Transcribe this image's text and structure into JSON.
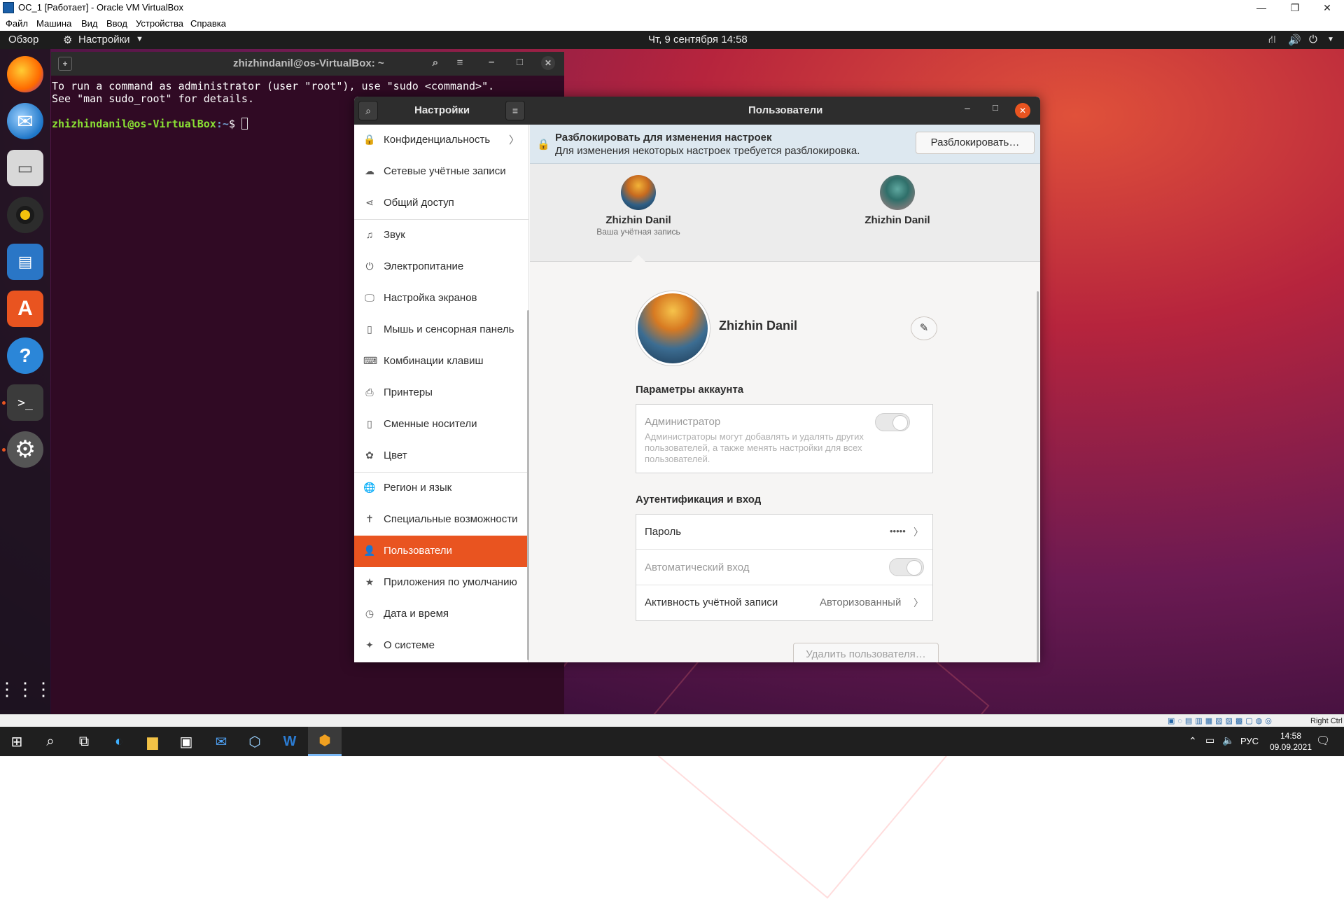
{
  "vbox": {
    "title": "ОС_1 [Работает] - Oracle VM VirtualBox",
    "menu": [
      "Файл",
      "Машина",
      "Вид",
      "Ввод",
      "Устройства",
      "Справка"
    ],
    "status_host_key": "Right Ctrl"
  },
  "topbar": {
    "activities": "Обзор",
    "app_menu": "Настройки",
    "clock": "Чт, 9 сентября  14:58"
  },
  "terminal": {
    "title": "zhizhindanil@os-VirtualBox: ~",
    "line1": "To run a command as administrator (user \"root\"), use \"sudo <command>\".",
    "line2": "See \"man sudo_root\" for details.",
    "prompt_user": "zhizhindanil@os-VirtualBox",
    "prompt_path": ":~",
    "prompt_sign": "$ "
  },
  "settings": {
    "sidebar_title": "Настройки",
    "page_title": "Пользователи",
    "sidebar_items": [
      "Конфиденциальность",
      "Сетевые учётные записи",
      "Общий доступ",
      "Звук",
      "Электропитание",
      "Настройка экранов",
      "Мышь и сенсорная панель",
      "Комбинации клавиш",
      "Принтеры",
      "Сменные носители",
      "Цвет",
      "Регион и язык",
      "Специальные возможности",
      "Пользователи",
      "Приложения по умолчанию",
      "Дата и время",
      "О системе"
    ],
    "unlock": {
      "title": "Разблокировать для изменения настроек",
      "subtitle": "Для изменения некоторых настроек требуется разблокировка.",
      "button": "Разблокировать…"
    },
    "users": [
      {
        "name": "Zhizhin Danil",
        "caption": "Ваша учётная запись"
      },
      {
        "name": "Zhizhin Danil",
        "caption": ""
      }
    ],
    "profile_name": "Zhizhin Danil",
    "account_section": "Параметры аккаунта",
    "admin_label": "Администратор",
    "admin_desc": "Администраторы могут добавлять и удалять других пользователей, а также менять настройки для всех пользователей.",
    "auth_section": "Аутентификация и вход",
    "password_label": "Пароль",
    "password_value": "•••••",
    "autologin_label": "Автоматический вход",
    "activity_label": "Активность учётной записи",
    "activity_value": "Авторизованный",
    "delete_button": "Удалить пользователя…"
  },
  "taskbar": {
    "lang": "РУС",
    "time": "14:58",
    "date": "09.09.2021"
  },
  "colors": {
    "accent": "#e95420",
    "header": "#2d2d2d",
    "terminal_bg": "#300a24"
  }
}
